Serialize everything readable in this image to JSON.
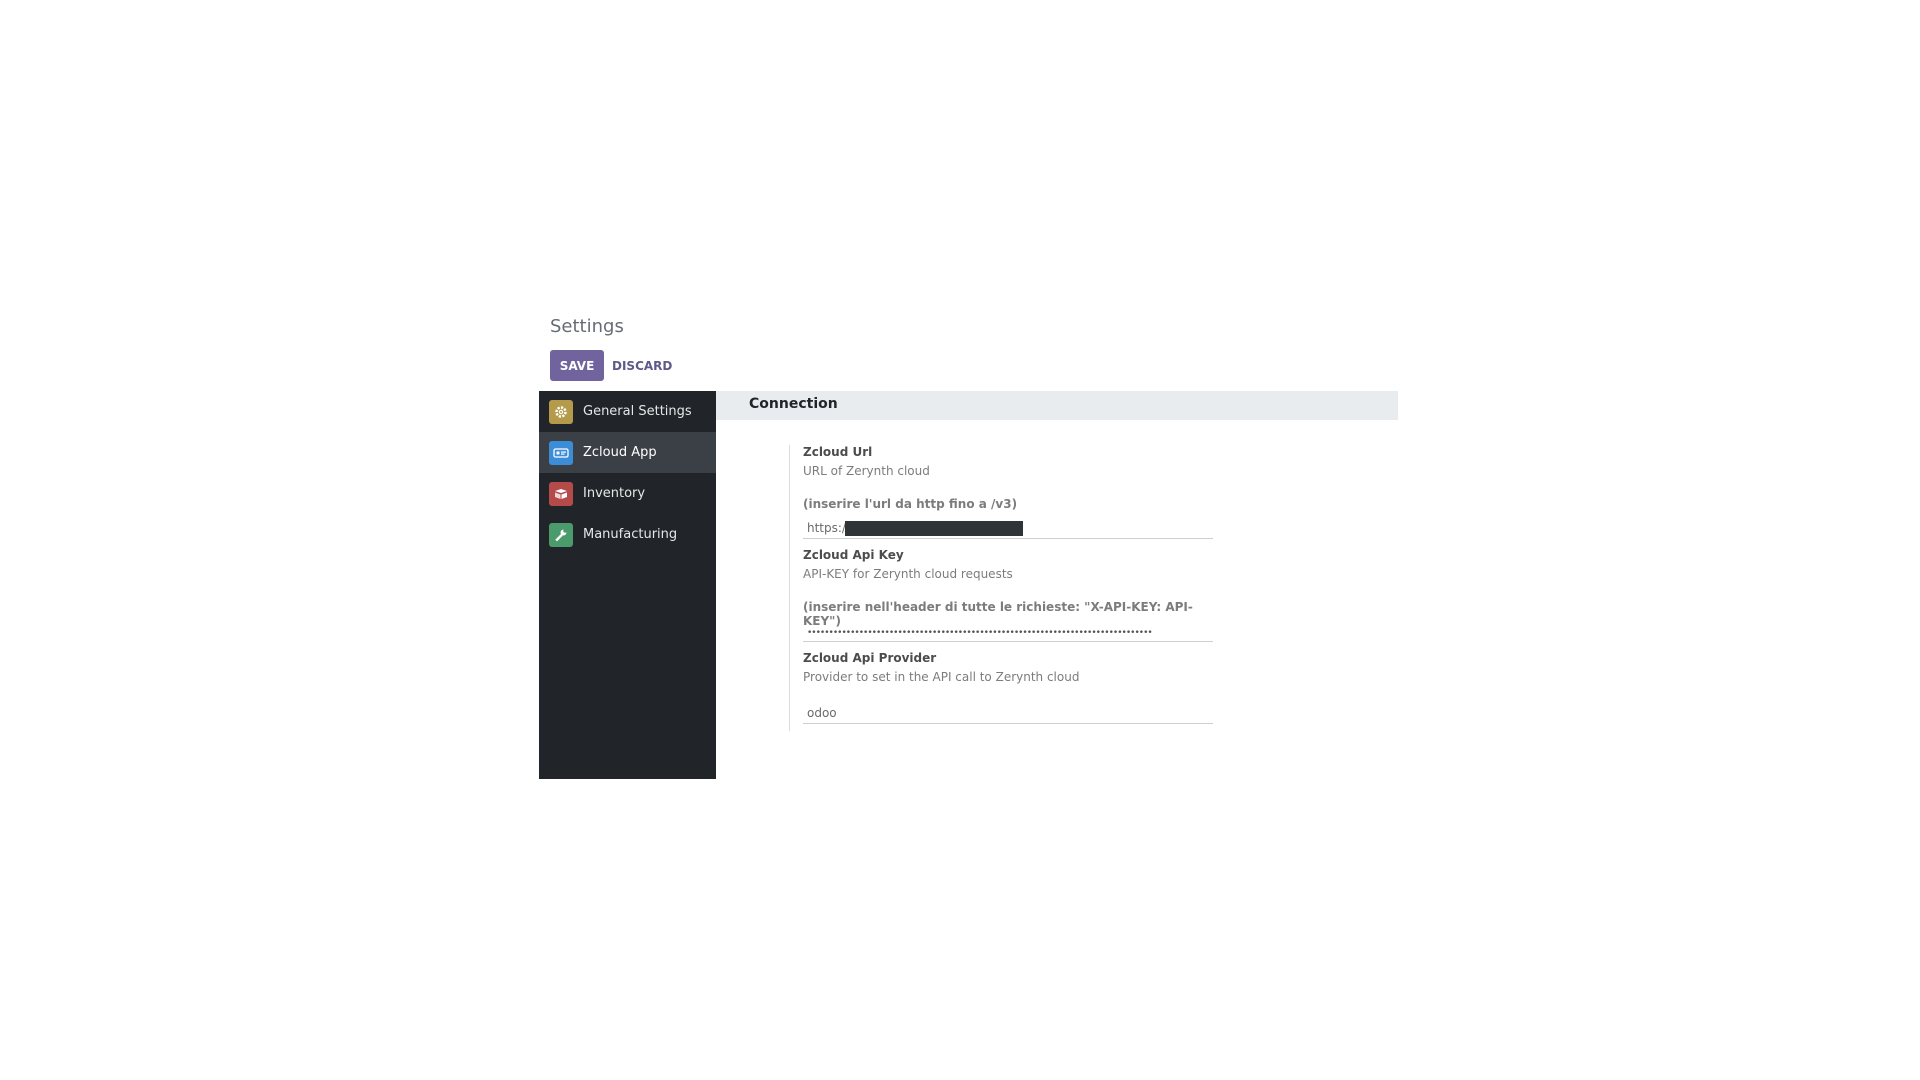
{
  "page": {
    "title": "Settings"
  },
  "toolbar": {
    "save_label": "SAVE",
    "discard_label": "DISCARD"
  },
  "sidebar": {
    "items": [
      {
        "label": "General Settings",
        "icon": "gear-icon",
        "color": "#b49a4a",
        "active": false
      },
      {
        "label": "Zcloud App",
        "icon": "cloud-app-icon",
        "color": "#3c8dd8",
        "active": true
      },
      {
        "label": "Inventory",
        "icon": "box-icon",
        "color": "#b44a4a",
        "active": false
      },
      {
        "label": "Manufacturing",
        "icon": "wrench-icon",
        "color": "#4a9a6b",
        "active": false
      }
    ]
  },
  "section": {
    "title": "Connection"
  },
  "fields": {
    "url": {
      "label": "Zcloud Url",
      "description": "URL of Zerynth cloud",
      "hint": "(inserire l'url da http fino a /v3)",
      "value": "https:/"
    },
    "api_key": {
      "label": "Zcloud Api Key",
      "description": "API-KEY for Zerynth cloud requests",
      "hint": "(inserire nell'header di tutte le richieste: \"X-API-KEY: API-KEY\")",
      "masked_value": "••••••••••••••••••••••••••••••••••••••••••••••••••••••••••••••••••••••••••••••••"
    },
    "provider": {
      "label": "Zcloud Api Provider",
      "description": "Provider to set in the API call to Zerynth cloud",
      "value": "odoo"
    }
  },
  "colors": {
    "accent": "#71639e",
    "sidebar_bg": "#212529",
    "section_header_bg": "#e9ecef"
  }
}
